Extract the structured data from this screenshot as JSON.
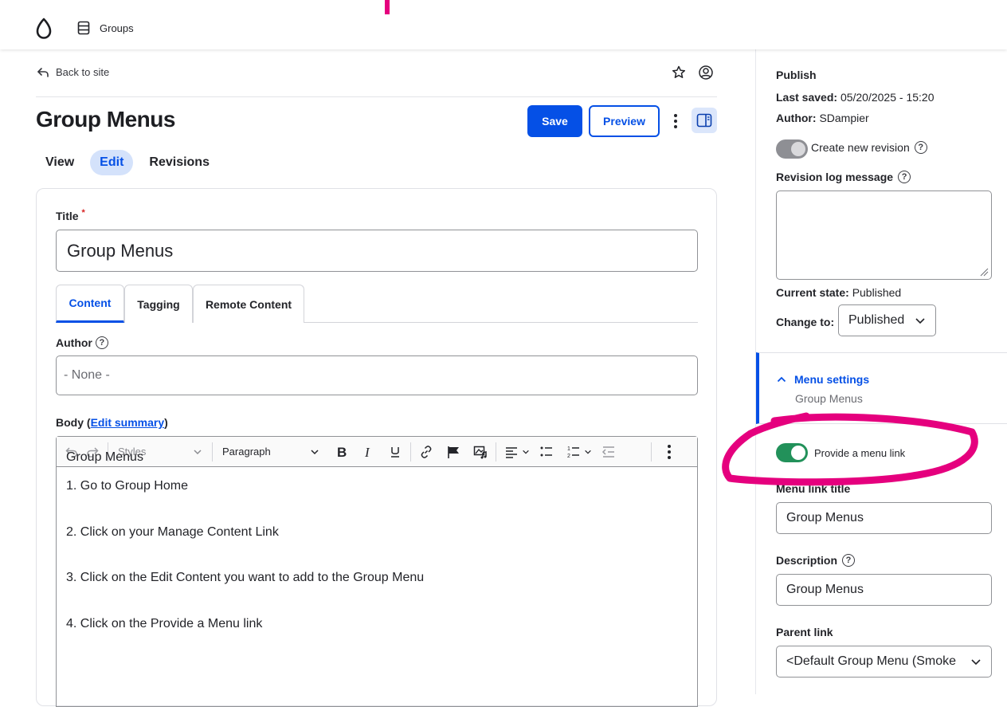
{
  "topbar": {
    "groups_label": "Groups"
  },
  "header": {
    "back_label": "Back to site",
    "page_title": "Group Menus",
    "save_label": "Save",
    "preview_label": "Preview"
  },
  "local_tabs": [
    {
      "label": "View"
    },
    {
      "label": "Edit"
    },
    {
      "label": "Revisions"
    }
  ],
  "form": {
    "title_label": "Title",
    "required_mark": "*",
    "title_value": "Group Menus",
    "tabs": [
      {
        "label": "Content"
      },
      {
        "label": "Tagging"
      },
      {
        "label": "Remote Content"
      }
    ],
    "author_label": "Author",
    "author_value": "- None -",
    "body_label_prefix": "Body (",
    "body_edit_summary": "Edit summary",
    "body_label_suffix": ")",
    "toolbar": {
      "styles": "Styles",
      "paragraph": "Paragraph"
    },
    "body_lines": [
      "Group Menus",
      "1. Go to Group Home",
      "2. Click on your Manage Content Link",
      "3. Click on the Edit Content you want to add to the Group Menu",
      "4. Click on the Provide a Menu link"
    ]
  },
  "sidebar": {
    "publish_heading": "Publish",
    "last_saved_label": "Last saved:",
    "last_saved_value": "05/20/2025 - 15:20",
    "author_label": "Author:",
    "author_value": "SDampier",
    "create_revision_label": "Create new revision",
    "revision_log_label": "Revision log message",
    "current_state_label": "Current state:",
    "current_state_value": "Published",
    "change_to_label": "Change to:",
    "change_to_value": "Published",
    "menu_settings_label": "Menu settings",
    "menu_settings_summary": "Group Menus",
    "provide_menu_link_label": "Provide a menu link",
    "menu_link_title_label": "Menu link title",
    "menu_link_title_value": "Group Menus",
    "description_label": "Description",
    "description_value": "Group Menus",
    "parent_link_label": "Parent link",
    "parent_link_value": "<Default Group Menu (Smoke"
  },
  "colors": {
    "primary": "#0550e6",
    "toggle_on": "#22915a",
    "annotation": "#e5007e"
  }
}
